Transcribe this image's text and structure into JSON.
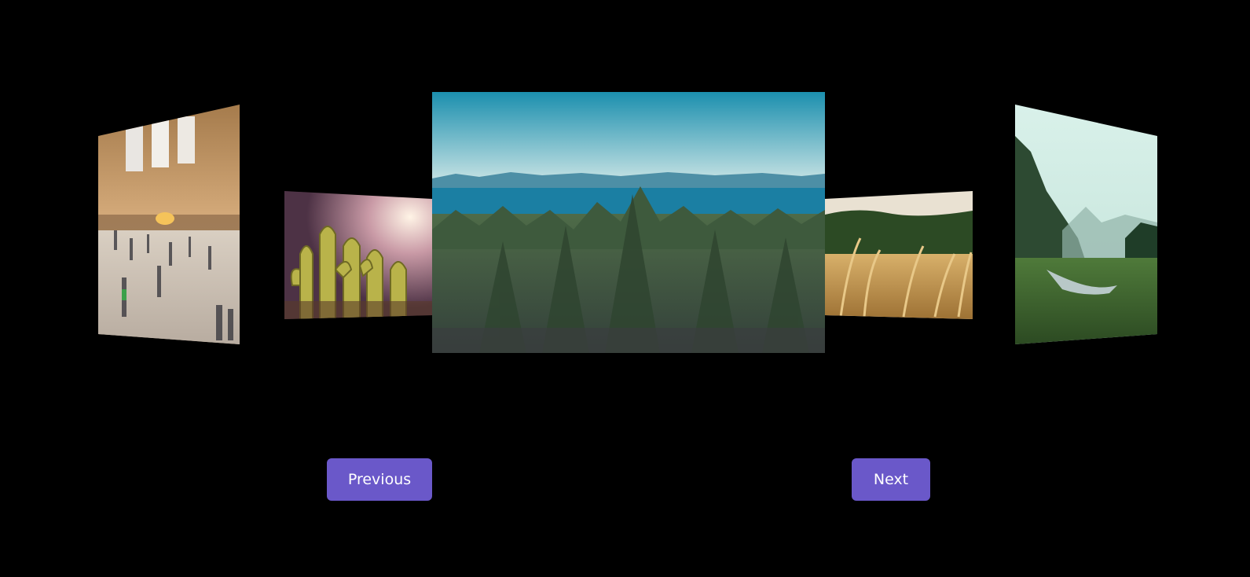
{
  "carousel": {
    "slides": [
      {
        "name": "train-station-concourse",
        "scene": "far-left"
      },
      {
        "name": "cactus-sunlight",
        "scene": "left"
      },
      {
        "name": "lake-forest-view",
        "scene": "center"
      },
      {
        "name": "golden-grass-field",
        "scene": "right"
      },
      {
        "name": "misty-valley-river",
        "scene": "far-right"
      }
    ]
  },
  "controls": {
    "previous_label": "Previous",
    "next_label": "Next",
    "button_color": "#6a58c9"
  }
}
